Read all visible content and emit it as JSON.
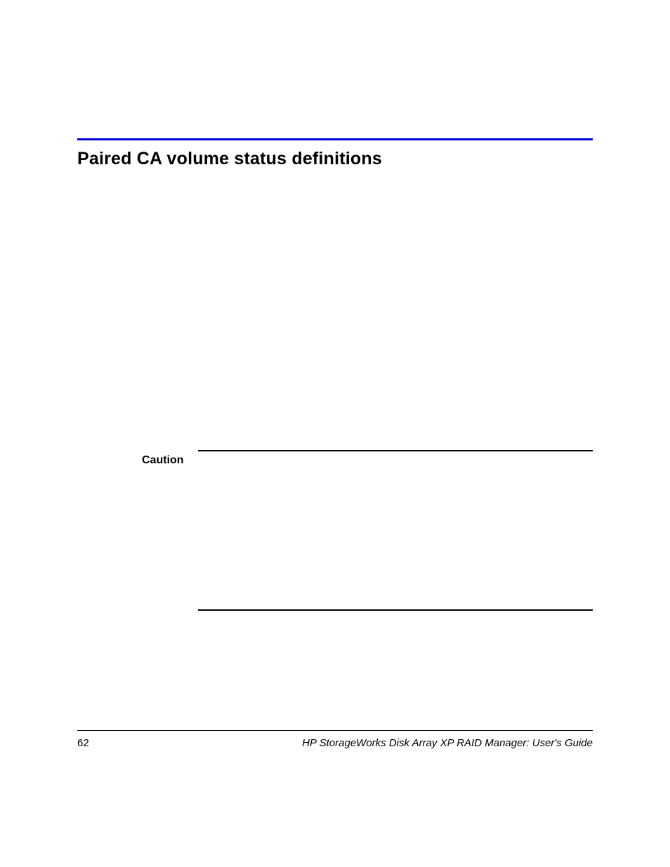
{
  "heading": "Paired CA volume status definitions",
  "caution": {
    "label": "Caution"
  },
  "footer": {
    "page_number": "62",
    "book_title": "HP StorageWorks Disk Array XP RAID Manager: User's Guide"
  },
  "colors": {
    "blue_rule": "#0000d6"
  }
}
